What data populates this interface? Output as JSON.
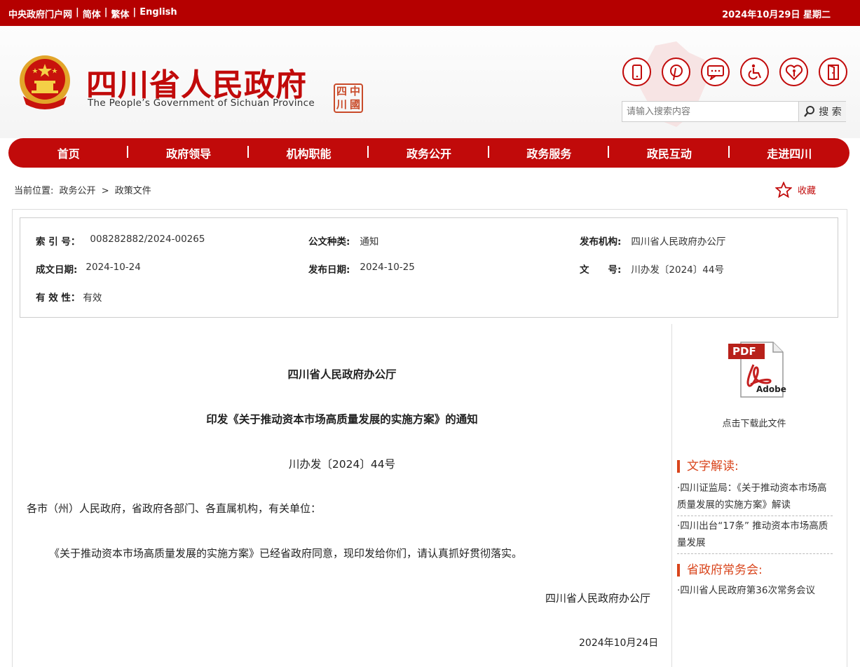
{
  "topbar": {
    "links": [
      "中央政府门户网",
      "简体",
      "繁体",
      "English"
    ],
    "separator": "|",
    "date": "2024年10月29日 星期二"
  },
  "header": {
    "title_cn": "四川省人民政府",
    "title_en": "The People’s Government of Sichuan Province",
    "seal_chars": [
      "中",
      "四",
      "國",
      "川"
    ],
    "search_placeholder": "请输入搜索内容",
    "search_button": "搜 索",
    "icons": [
      "mobile-icon",
      "pinterest-icon",
      "chat-icon",
      "accessibility-icon",
      "elderly-care-icon",
      "exit-icon"
    ]
  },
  "nav": [
    "首页",
    "政府领导",
    "机构职能",
    "政务公开",
    "政务服务",
    "政民互动",
    "走进四川"
  ],
  "breadcrumb": {
    "prefix": "当前位置:",
    "items": [
      "政务公开",
      ">",
      "政策文件"
    ],
    "favorite": "收藏"
  },
  "meta": {
    "index_label": "索 引 号：",
    "index_value": "008282882/2024-00265",
    "type_label": "公文种类:",
    "type_value": "通知",
    "issuer_label": "发布机构:",
    "issuer_value": "四川省人民政府办公厅",
    "written_label": "成文日期:",
    "written_value": "2024-10-24",
    "published_label": "发布日期:",
    "published_value": "2024-10-25",
    "doc_no_label": "文　　号:",
    "doc_no_value": "川办发〔2024〕44号",
    "validity_label": "有 效 性：",
    "validity_value": "有效"
  },
  "article": {
    "issuer": "四川省人民政府办公厅",
    "title": "印发《关于推动资本市场高质量发展的实施方案》的通知",
    "doc_no": "川办发〔2024〕44号",
    "salutation": "各市（州）人民政府，省政府各部门、各直属机构，有关单位：",
    "body": "《关于推动资本市场高质量发展的实施方案》已经省政府同意，现印发给你们，请认真抓好贯彻落实。",
    "signature": "四川省人民政府办公厅",
    "date": "2024年10月24日"
  },
  "sidebar": {
    "pdf_label": "PDF",
    "pdf_brand": "Adobe",
    "download": "点击下载此文件",
    "section1": "文字解读:",
    "link1": "·四川证监局：《关于推动资本市场高质量发展的实施方案》解读",
    "link2": "·四川出台“17条” 推动资本市场高质量发展",
    "section2": "省政府常务会:",
    "link3": "·四川省人民政府第36次常务会议"
  },
  "colors": {
    "brand_red": "#c10a0a",
    "topbar_red": "#b50000",
    "section_orange": "#d9451c"
  }
}
